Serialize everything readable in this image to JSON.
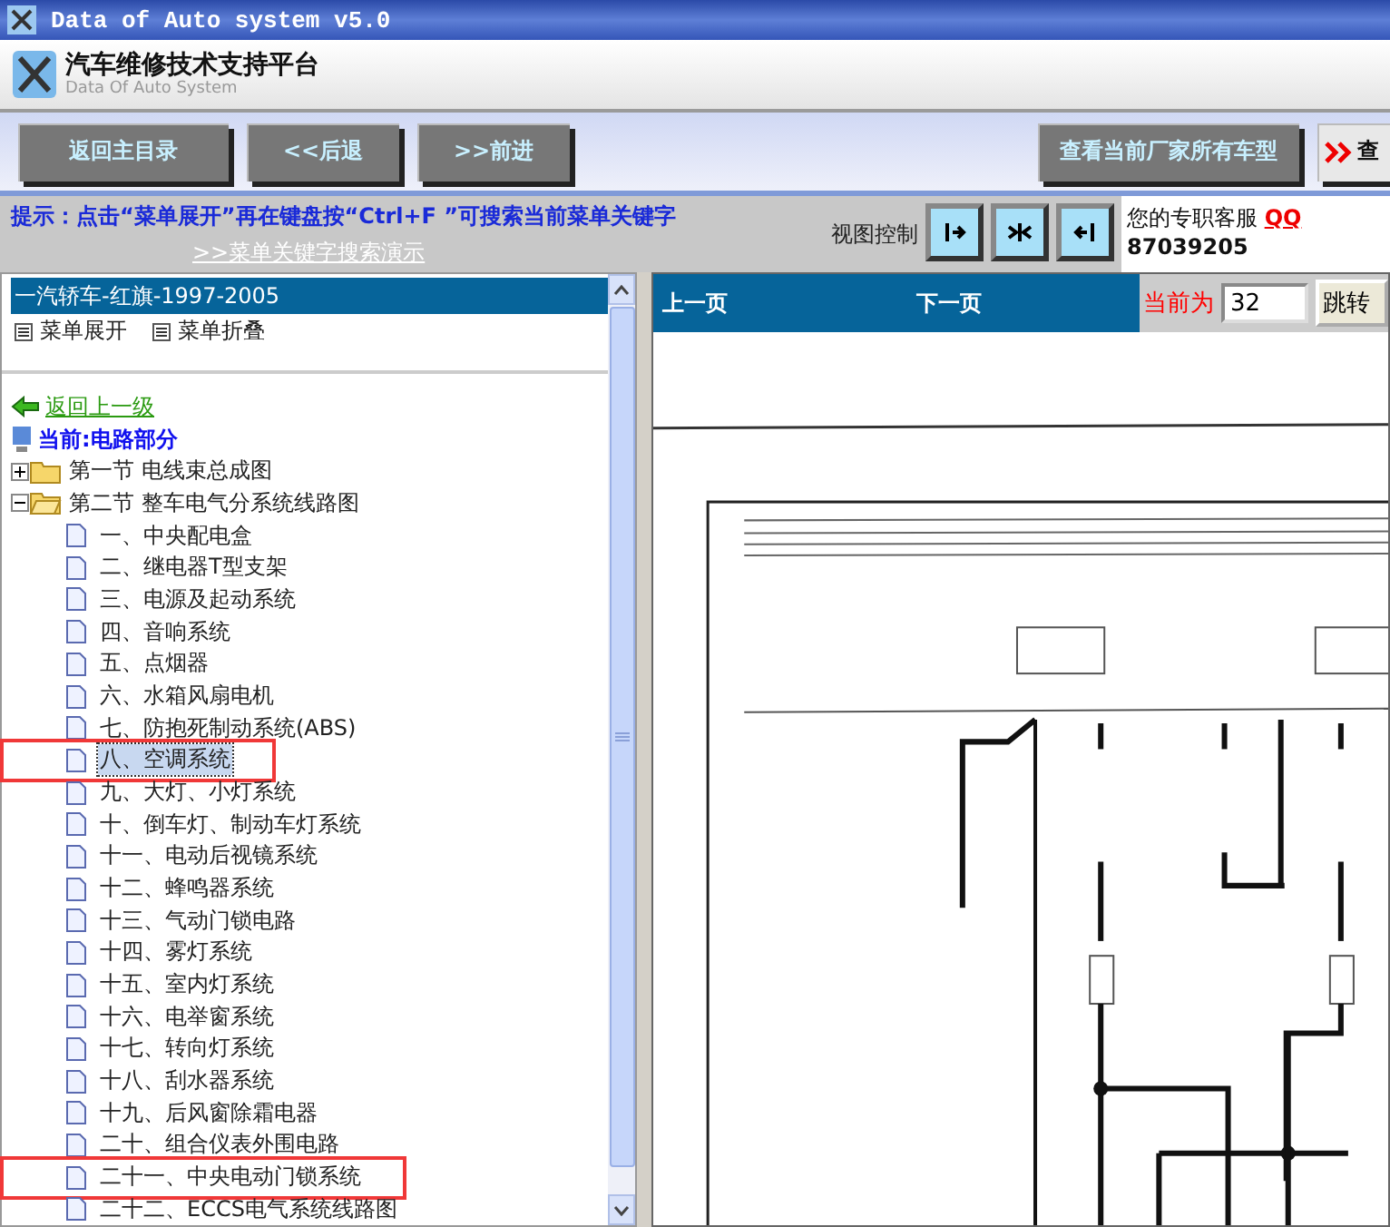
{
  "window": {
    "title": "Data of Auto system v5.0"
  },
  "header": {
    "title": "汽车维修技术支持平台",
    "subtitle": "Data Of Auto System"
  },
  "toolbar": {
    "buttons": [
      "返回主目录",
      "<<后退",
      ">>前进"
    ],
    "models_button": "查看当前厂家所有车型",
    "search_button": "查"
  },
  "hint": {
    "text": "提示：点击“菜单展开”再在键盘按“Ctrl+F ”可搜索当前菜单关键字",
    "link": ">>菜单关键字搜索演示",
    "view_label": "视图控制",
    "service_label": "您的专职客服",
    "qq": "QQ",
    "phone": "87039205"
  },
  "sidebar": {
    "car": "一汽轿车-红旗-1997-2005",
    "expand": "菜单展开",
    "collapse": "菜单折叠",
    "back": "返回上一级",
    "current": "当前:电路部分",
    "tree": [
      {
        "label": "第一节  电线束总成图",
        "expanded": false
      },
      {
        "label": "第二节  整车电气分系统线路图",
        "expanded": true,
        "children": [
          {
            "label": "一、中央配电盒",
            "selected": false,
            "highlighted": false
          },
          {
            "label": "二、继电器T型支架",
            "selected": false,
            "highlighted": false
          },
          {
            "label": "三、电源及起动系统",
            "selected": false,
            "highlighted": false
          },
          {
            "label": "四、音响系统",
            "selected": false,
            "highlighted": false
          },
          {
            "label": "五、点烟器",
            "selected": false,
            "highlighted": false
          },
          {
            "label": "六、水箱风扇电机",
            "selected": false,
            "highlighted": false
          },
          {
            "label": "七、防抱死制动系统(ABS)",
            "selected": false,
            "highlighted": false
          },
          {
            "label": "八、空调系统",
            "selected": true,
            "highlighted": true
          },
          {
            "label": "九、大灯、小灯系统",
            "selected": false,
            "highlighted": false
          },
          {
            "label": "十、倒车灯、制动车灯系统",
            "selected": false,
            "highlighted": false
          },
          {
            "label": "十一、电动后视镜系统",
            "selected": false,
            "highlighted": false
          },
          {
            "label": "十二、蜂鸣器系统",
            "selected": false,
            "highlighted": false
          },
          {
            "label": "十三、气动门锁电路",
            "selected": false,
            "highlighted": false
          },
          {
            "label": "十四、雾灯系统",
            "selected": false,
            "highlighted": false
          },
          {
            "label": "十五、室内灯系统",
            "selected": false,
            "highlighted": false
          },
          {
            "label": "十六、电举窗系统",
            "selected": false,
            "highlighted": false
          },
          {
            "label": "十七、转向灯系统",
            "selected": false,
            "highlighted": false
          },
          {
            "label": "十八、刮水器系统",
            "selected": false,
            "highlighted": false
          },
          {
            "label": "十九、后风窗除霜电器",
            "selected": false,
            "highlighted": false
          },
          {
            "label": "二十、组合仪表外围电路",
            "selected": false,
            "highlighted": false
          },
          {
            "label": "二十一、中央电动门锁系统",
            "selected": false,
            "highlighted": true
          },
          {
            "label": "二十二、ECCS电气系统线路图",
            "selected": false,
            "highlighted": false
          }
        ]
      }
    ]
  },
  "viewer": {
    "prev": "上一页",
    "next": "下一页",
    "current_label": "当前为",
    "page": "32",
    "jump": "跳转"
  }
}
